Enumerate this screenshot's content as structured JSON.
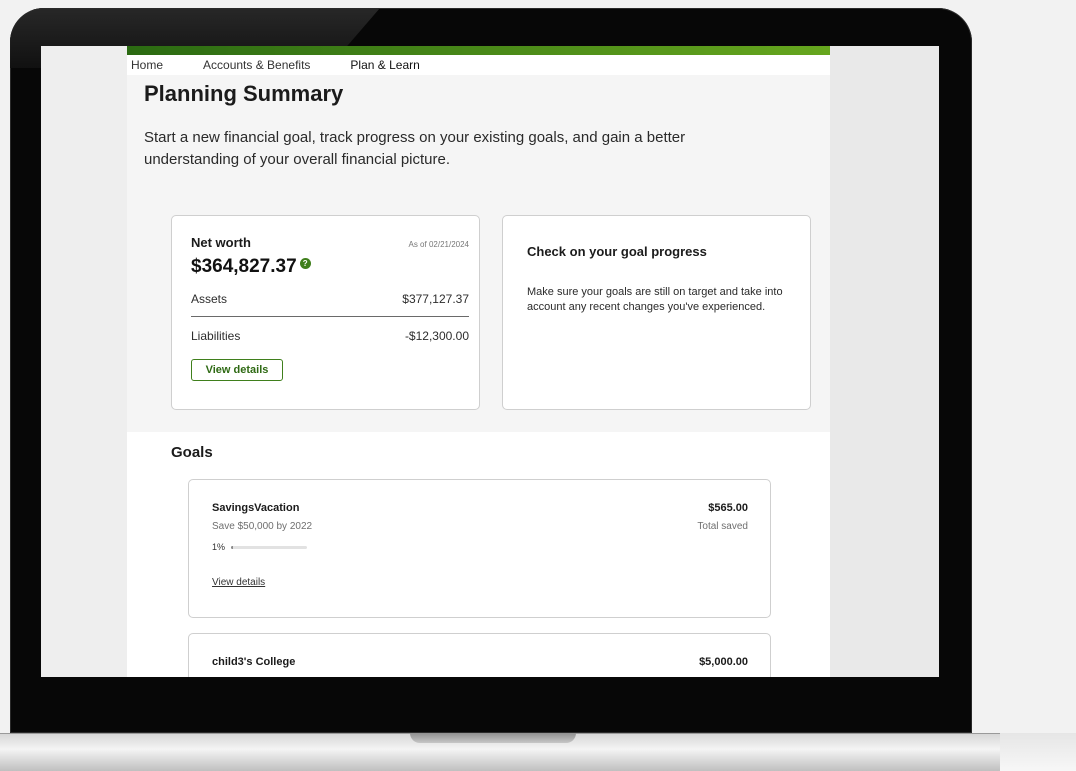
{
  "nav": {
    "items": [
      {
        "label": "Home",
        "active": false
      },
      {
        "label": "Accounts & Benefits",
        "active": false
      },
      {
        "label": "Plan & Learn",
        "active": true
      }
    ]
  },
  "page": {
    "title": "Planning Summary",
    "intro": "Start a new financial goal, track progress on your existing goals, and gain a better understanding of your overall financial picture."
  },
  "net_worth": {
    "label": "Net worth",
    "as_of": "As of 02/21/2024",
    "value": "$364,827.37",
    "help_glyph": "?",
    "assets_label": "Assets",
    "assets_value": "$377,127.37",
    "liabilities_label": "Liabilities",
    "liabilities_value": "-$12,300.00",
    "view_details_label": "View details"
  },
  "goal_progress": {
    "title": "Check on your goal progress",
    "text": "Make sure your goals are still on target and take into account any recent changes you've experienced."
  },
  "goals": {
    "heading": "Goals",
    "items": [
      {
        "name": "SavingsVacation",
        "amount": "$565.00",
        "subtitle": "Save $50,000 by 2022",
        "saved_label": "Total saved",
        "percent_label": "1%",
        "progress_fraction": 0.01,
        "link_label": "View details"
      },
      {
        "name": "child3's College",
        "amount": "$5,000.00"
      }
    ]
  },
  "colors": {
    "accent_green_dark": "#2b6a12",
    "accent_green_light": "#66a61e",
    "button_green": "#3f7f1c"
  }
}
